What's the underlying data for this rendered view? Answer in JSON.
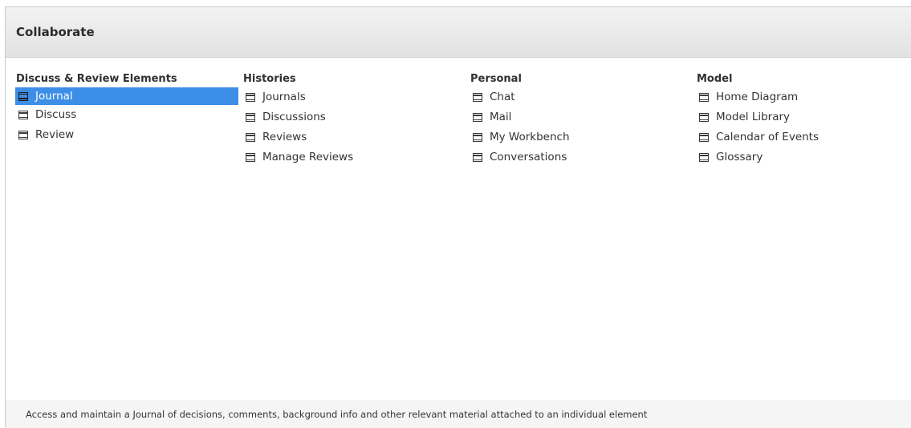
{
  "header": {
    "title": "Collaborate"
  },
  "columns": [
    {
      "heading": "Discuss & Review Elements",
      "items": [
        {
          "label": "Journal",
          "icon": "panel-icon",
          "selected": true
        },
        {
          "label": "Discuss",
          "icon": "panel-icon",
          "selected": false
        },
        {
          "label": "Review",
          "icon": "panel-icon",
          "selected": false
        }
      ]
    },
    {
      "heading": "Histories",
      "items": [
        {
          "label": "Journals",
          "icon": "panel-icon",
          "selected": false
        },
        {
          "label": "Discussions",
          "icon": "panel-icon",
          "selected": false
        },
        {
          "label": "Reviews",
          "icon": "panel-icon",
          "selected": false
        },
        {
          "label": "Manage Reviews",
          "icon": "panel-icon",
          "selected": false
        }
      ]
    },
    {
      "heading": "Personal",
      "items": [
        {
          "label": "Chat",
          "icon": "panel-icon",
          "selected": false
        },
        {
          "label": "Mail",
          "icon": "panel-icon",
          "selected": false
        },
        {
          "label": "My Workbench",
          "icon": "panel-icon",
          "selected": false
        },
        {
          "label": "Conversations",
          "icon": "panel-icon",
          "selected": false
        }
      ]
    },
    {
      "heading": "Model",
      "items": [
        {
          "label": "Home Diagram",
          "icon": "panel-icon",
          "selected": false
        },
        {
          "label": "Model Library",
          "icon": "panel-icon",
          "selected": false
        },
        {
          "label": "Calendar of Events",
          "icon": "panel-icon",
          "selected": false
        },
        {
          "label": "Glossary",
          "icon": "panel-icon",
          "selected": false
        }
      ]
    }
  ],
  "footer": {
    "description": "Access and maintain a Journal of decisions, comments, background info and other relevant material attached to an individual element"
  },
  "colors": {
    "selection": "#3d8ee6",
    "header_bg": "#e8e8e8",
    "footer_bg": "#f5f5f5"
  }
}
